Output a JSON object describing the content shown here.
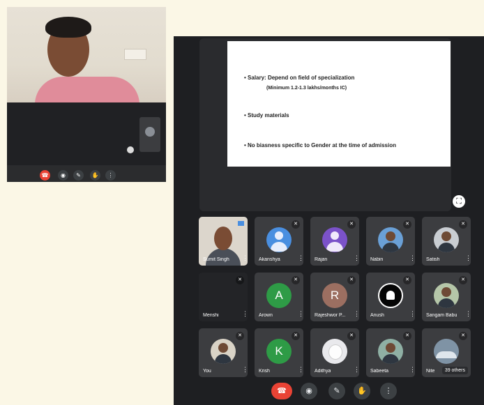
{
  "mini_window": {
    "controls": [
      {
        "icon": "end-call-icon",
        "glyph": "☎"
      },
      {
        "icon": "camera-off-icon",
        "glyph": "◉"
      },
      {
        "icon": "mic-off-icon",
        "glyph": "✎"
      },
      {
        "icon": "raise-hand-icon",
        "glyph": "✋"
      },
      {
        "icon": "more-options-icon",
        "glyph": "⋮"
      }
    ]
  },
  "slide": {
    "bullets": [
      "Salary: Depend on field of specialization",
      "Study materials",
      "No biasness specific to Gender at the time of admission"
    ],
    "sub_bullet": "(Minimum 1.2-1.3 lakhs/months IC)"
  },
  "participants": [
    {
      "name": "Sumit Singh",
      "type": "video"
    },
    {
      "name": "Akanshya",
      "type": "default",
      "color": "#4a8fe0"
    },
    {
      "name": "Rajan",
      "type": "default",
      "color": "#7b52c9"
    },
    {
      "name": "Nabin",
      "type": "photo"
    },
    {
      "name": "Satish",
      "type": "photo"
    },
    {
      "name": "Menshi",
      "type": "blank"
    },
    {
      "name": "Arown",
      "type": "letter",
      "letter": "A",
      "color": "#2e9b46"
    },
    {
      "name": "Rajeshwor P...",
      "type": "letter",
      "letter": "R",
      "color": "#9c6f61"
    },
    {
      "name": "Anush",
      "type": "logo"
    },
    {
      "name": "Sangam Babu",
      "type": "photo"
    },
    {
      "name": "You",
      "type": "photo"
    },
    {
      "name": "Krish",
      "type": "letter",
      "letter": "K",
      "color": "#2e9b46"
    },
    {
      "name": "Adithya",
      "type": "photo"
    },
    {
      "name": "Sabeeta",
      "type": "photo"
    },
    {
      "name": "Nite",
      "type": "photo"
    }
  ],
  "others_count_label": "39 others",
  "controls": [
    {
      "icon": "end-call-icon",
      "glyph": "☎"
    },
    {
      "icon": "camera-off-icon",
      "glyph": "◉"
    },
    {
      "icon": "mic-off-icon",
      "glyph": "✎"
    },
    {
      "icon": "raise-hand-icon",
      "glyph": "✋"
    },
    {
      "icon": "more-options-icon",
      "glyph": "⋮"
    }
  ],
  "icons": {
    "fullscreen": "⛶",
    "mute": "✕",
    "more": "⋮"
  }
}
